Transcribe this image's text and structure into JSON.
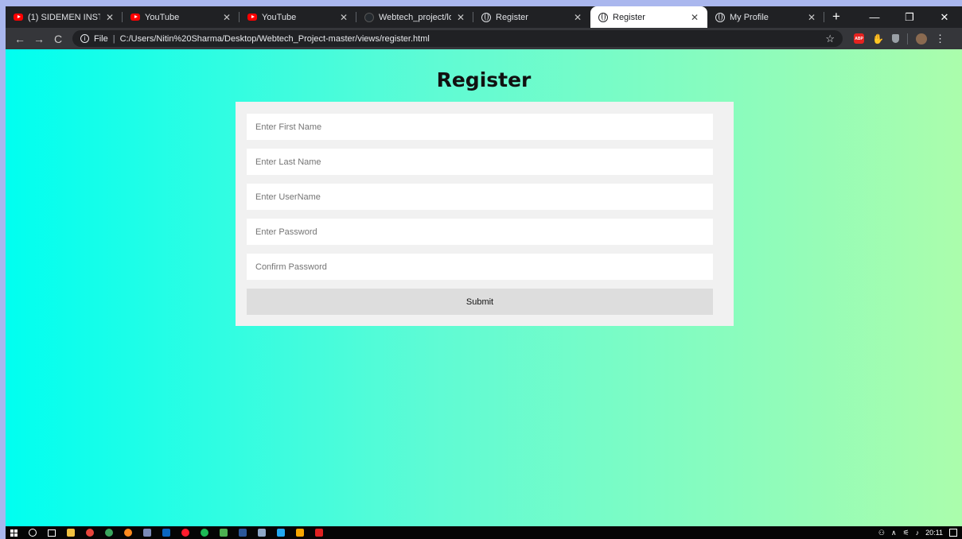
{
  "tabs": [
    {
      "title": "(1) SIDEMEN INSTAGRA",
      "icon": "youtube-icon",
      "active": false
    },
    {
      "title": "YouTube",
      "icon": "youtube-icon",
      "active": false
    },
    {
      "title": "YouTube",
      "icon": "youtube-icon",
      "active": false
    },
    {
      "title": "Webtech_project/login",
      "icon": "github-icon",
      "active": false
    },
    {
      "title": "Register",
      "icon": "globe-icon",
      "active": false
    },
    {
      "title": "Register",
      "icon": "globe-icon",
      "active": true
    },
    {
      "title": "My Profile",
      "icon": "globe-icon",
      "active": false
    }
  ],
  "toolbar": {
    "scheme_label": "File",
    "url": "C:/Users/Nitin%20Sharma/Desktop/Webtech_Project-master/views/register.html"
  },
  "page": {
    "title": "Register",
    "fields": {
      "first_name": {
        "placeholder": "Enter First Name",
        "value": ""
      },
      "last_name": {
        "placeholder": "Enter Last Name",
        "value": ""
      },
      "username": {
        "placeholder": "Enter UserName",
        "value": ""
      },
      "password": {
        "placeholder": "Enter Password",
        "value": ""
      },
      "confirm_password": {
        "placeholder": "Confirm Password",
        "value": ""
      }
    },
    "submit_label": "Submit"
  },
  "taskbar": {
    "clock": "20:11"
  },
  "colors": {
    "gradient_start": "#00fff0",
    "gradient_end": "#abfdac",
    "card_bg": "#f1f1f1",
    "button_bg": "#dddddd"
  }
}
